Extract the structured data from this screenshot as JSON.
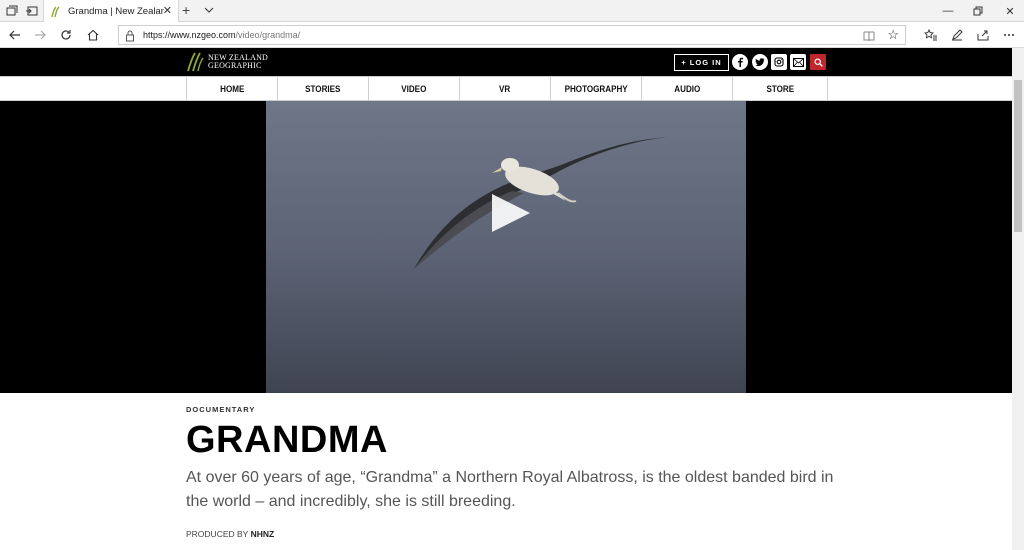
{
  "browser": {
    "tab_title": "Grandma | New Zealand",
    "url_domain": "https://www.nzgeo.com",
    "url_path": "/video/grandma/"
  },
  "site": {
    "logo_line1": "NEW ZEALAND",
    "logo_line2": "GEOGRAPHIC",
    "login_label": "+ LOG IN",
    "nav": [
      "HOME",
      "STORIES",
      "VIDEO",
      "VR",
      "PHOTOGRAPHY",
      "AUDIO",
      "STORE"
    ]
  },
  "article": {
    "kicker": "DOCUMENTARY",
    "title": "GRANDMA",
    "lede": "At over 60 years of age, “Grandma” a Northern Royal Albatross, is the oldest banded bird in the world – and incredibly, she is still breeding.",
    "producer_prefix": "PRODUCED BY",
    "producer_name": "NHNZ"
  },
  "colors": {
    "header_bg": "#000000",
    "search_button": "#c0262d",
    "logo_green": "#8fa83a"
  }
}
